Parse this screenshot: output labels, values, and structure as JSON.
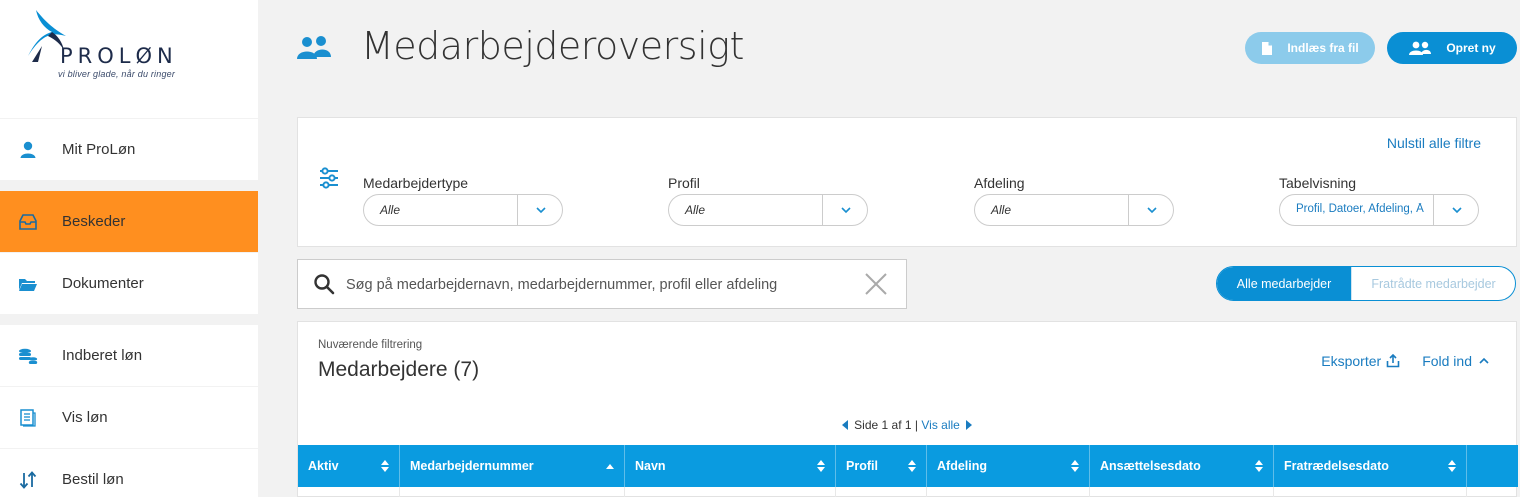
{
  "brand": {
    "name": "PROLØN",
    "tagline": "vi bliver glade, når du ringer"
  },
  "sidebar": {
    "items": [
      {
        "label": "Mit ProLøn",
        "icon": "user-icon"
      },
      {
        "label": "Beskeder",
        "icon": "inbox-icon",
        "active": true
      },
      {
        "label": "Dokumenter",
        "icon": "folder-icon"
      },
      {
        "label": "Indberet løn",
        "icon": "coins-icon"
      },
      {
        "label": "Vis løn",
        "icon": "document-icon"
      },
      {
        "label": "Bestil løn",
        "icon": "sort-arrows-icon"
      }
    ]
  },
  "header": {
    "title": "Medarbejderoversigt",
    "import_label": "Indlæs fra fil",
    "create_label": "Opret ny"
  },
  "filters": {
    "reset_label": "Nulstil alle filtre",
    "groups": [
      {
        "label": "Medarbejdertype",
        "value": "Alle"
      },
      {
        "label": "Profil",
        "value": "Alle"
      },
      {
        "label": "Afdeling",
        "value": "Alle"
      },
      {
        "label": "Tabelvisning",
        "value": "Profil, Datoer, Afdeling, Å"
      }
    ]
  },
  "search": {
    "placeholder": "Søg på medarbejdernavn, medarbejdernummer, profil eller afdeling"
  },
  "toggle": {
    "active_label": "Alle medarbejder",
    "inactive_label": "Fratrådte medarbejder"
  },
  "table": {
    "filter_caption": "Nuværende filtrering",
    "title": "Medarbejdere (7)",
    "export_label": "Eksporter",
    "collapse_label": "Fold ind",
    "pager": {
      "text": "Side 1 af 1",
      "separator": "|",
      "all_label": "Vis alle"
    },
    "columns": [
      "Aktiv",
      "Medarbejdernummer",
      "Navn",
      "Profil",
      "Afdeling",
      "Ansættelsesdato",
      "Fratrædelsesdato"
    ]
  },
  "colors": {
    "accent": "#0a8fd4",
    "active_nav": "#ff8f1f",
    "header_row": "#0a9be0"
  }
}
